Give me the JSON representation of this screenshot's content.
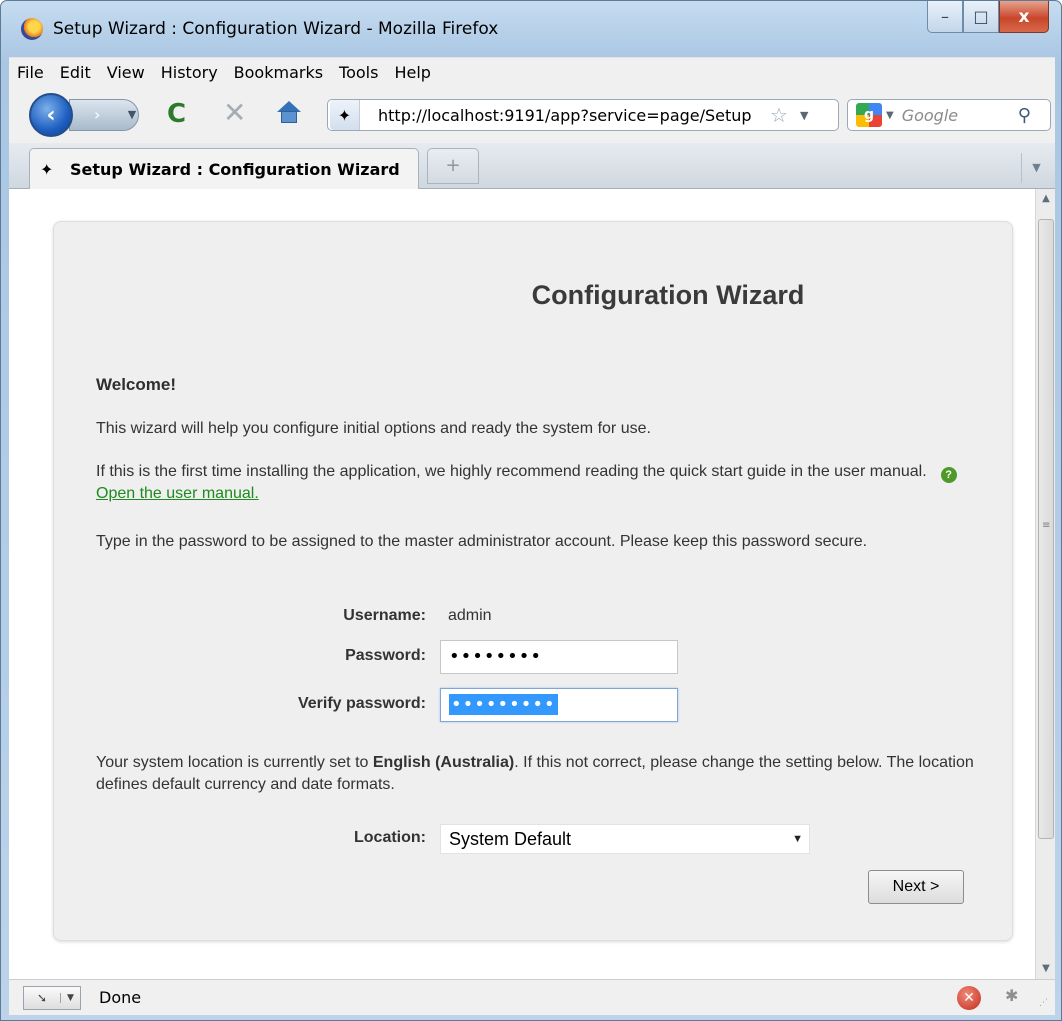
{
  "window": {
    "title": "Setup Wizard : Configuration Wizard - Mozilla Firefox",
    "controls": {
      "minimize": "–",
      "maximize": "□",
      "close": "x"
    }
  },
  "menu": {
    "items": [
      {
        "label": "File"
      },
      {
        "label": "Edit"
      },
      {
        "label": "View"
      },
      {
        "label": "History"
      },
      {
        "label": "Bookmarks"
      },
      {
        "label": "Tools"
      },
      {
        "label": "Help"
      }
    ]
  },
  "toolbar": {
    "url": "http://localhost:9191/app?service=page/Setup",
    "search_placeholder": "Google"
  },
  "tabs": [
    {
      "label": "Setup Wizard : Configuration Wizard",
      "active": true
    }
  ],
  "page": {
    "title": "Configuration Wizard",
    "welcome": "Welcome!",
    "intro": "This wizard will help you configure initial options and ready the system for use.",
    "manual_text": "If this is the first time installing the application, we highly recommend reading the quick start guide in the user manual.",
    "manual_link": "Open the user manual.",
    "password_instructions": "Type in the password to be assigned to the master administrator account. Please keep this password secure.",
    "form": {
      "username_label": "Username:",
      "username_value": "admin",
      "password_label": "Password:",
      "password_value": "••••••••",
      "verify_label": "Verify password:",
      "verify_value": "•••••••••"
    },
    "location_text_before": "Your system location is currently set to",
    "location_current": "English (Australia)",
    "location_text_after": ". If this not correct, please change the setting below. The location defines default currency and date formats.",
    "location_label": "Location:",
    "location_selected": "System Default",
    "next_button": "Next >"
  },
  "status": {
    "text": "Done"
  },
  "colors": {
    "panel_bg": "#efefef",
    "link_green": "#1f8a1f",
    "selection_blue": "#3399ff"
  }
}
